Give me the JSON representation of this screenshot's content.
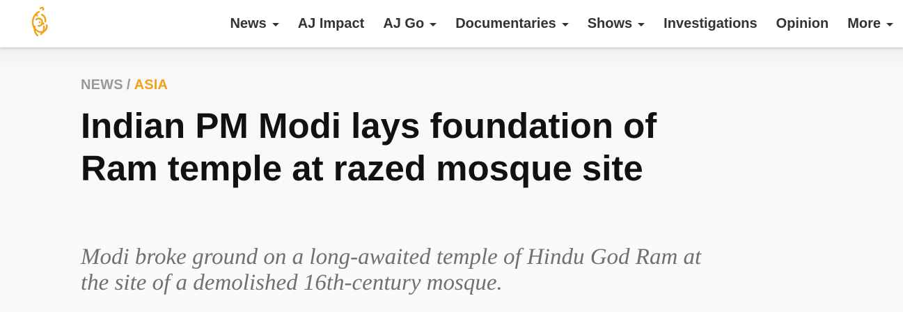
{
  "header": {
    "logo_icon": "al-jazeera-logo-icon",
    "nav": [
      {
        "label": "News",
        "dropdown": true
      },
      {
        "label": "AJ Impact",
        "dropdown": false
      },
      {
        "label": "AJ Go",
        "dropdown": true
      },
      {
        "label": "Documentaries",
        "dropdown": true
      },
      {
        "label": "Shows",
        "dropdown": true
      },
      {
        "label": "Investigations",
        "dropdown": false
      },
      {
        "label": "Opinion",
        "dropdown": false
      },
      {
        "label": "More",
        "dropdown": true
      }
    ]
  },
  "article": {
    "breadcrumb": {
      "section": "NEWS",
      "separator": "/",
      "category": "ASIA"
    },
    "headline": "Indian PM Modi lays foundation of Ram temple at razed mosque site",
    "subheadline": "Modi broke ground on a long-awaited temple of Hindu God Ram at the site of a demolished 16th-century mosque."
  },
  "colors": {
    "brand_gold": "#f2a11c",
    "nav_text": "#333333",
    "headline_text": "#111111",
    "subhead_text": "#707070",
    "breadcrumb_gray": "#999999"
  }
}
